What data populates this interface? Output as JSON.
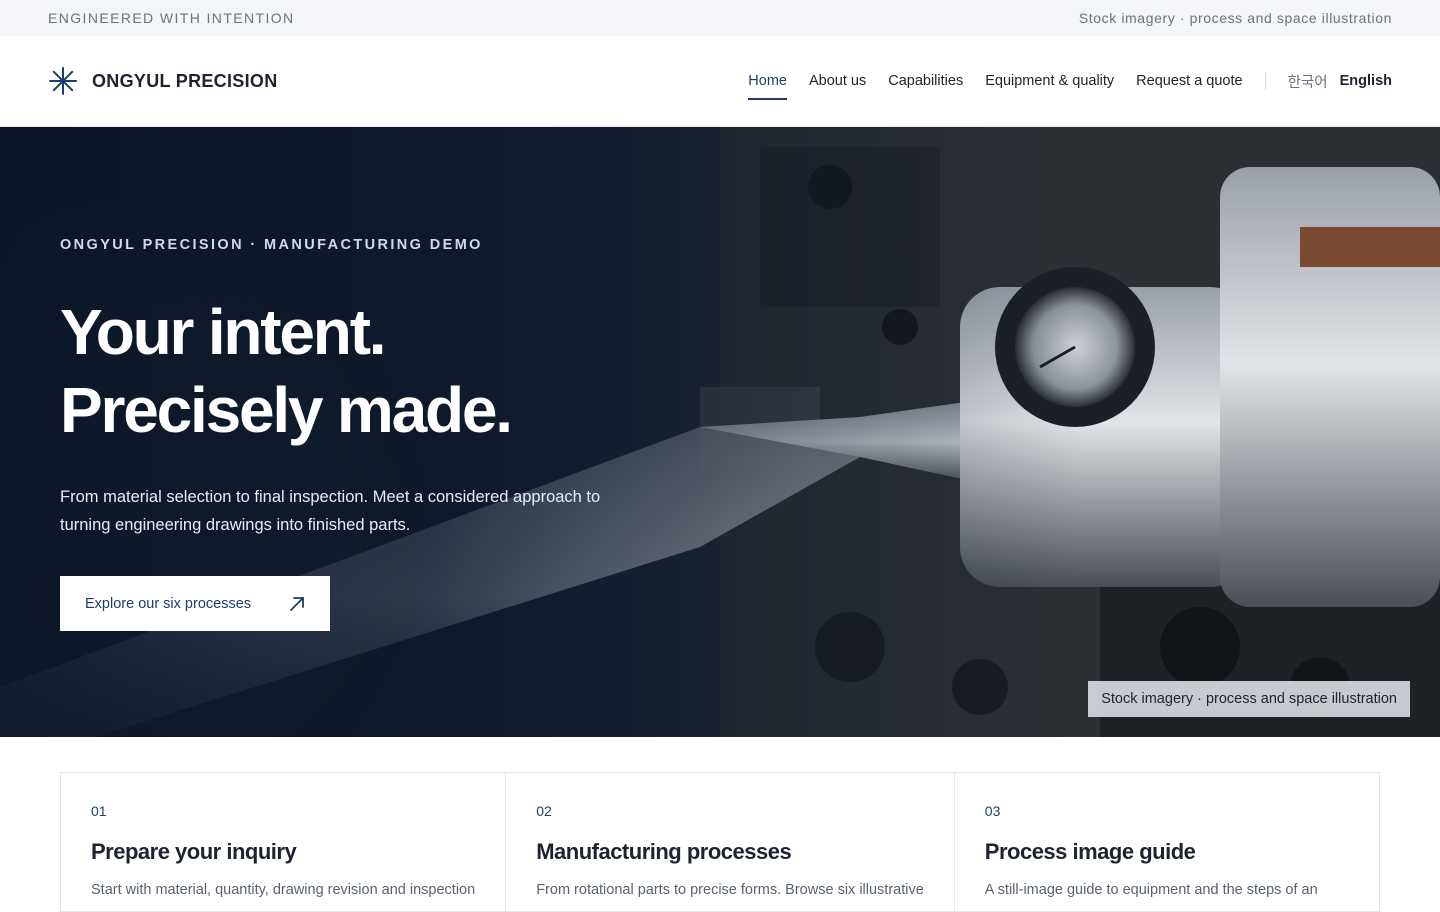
{
  "topbar": {
    "tagline": "ENGINEERED WITH INTENTION",
    "note": "Stock imagery · process and space illustration"
  },
  "header": {
    "brand": "ONGYUL PRECISION",
    "nav": [
      {
        "label": "Home",
        "active": true
      },
      {
        "label": "About us",
        "active": false
      },
      {
        "label": "Capabilities",
        "active": false
      },
      {
        "label": "Equipment & quality",
        "active": false
      },
      {
        "label": "Request a quote",
        "active": false
      }
    ],
    "languages": {
      "korean": "한국어",
      "english": "English",
      "selected": "English"
    }
  },
  "hero": {
    "eyebrow": "ONGYUL PRECISION · MANUFACTURING DEMO",
    "headline_line1": "Your intent.",
    "headline_line2": "Precisely made.",
    "lede": "From material selection to final inspection. Meet a considered approach to turning engineering drawings into finished parts.",
    "cta_label": "Explore our six processes",
    "image_credit": "Stock imagery · process and space illustration"
  },
  "cards": [
    {
      "number": "01",
      "title": "Prepare your inquiry",
      "text": "Start with material, quantity, drawing revision and inspection"
    },
    {
      "number": "02",
      "title": "Manufacturing processes",
      "text": "From rotational parts to precise forms. Browse six illustrative"
    },
    {
      "number": "03",
      "title": "Process image guide",
      "text": "A still-image guide to equipment and the steps of an"
    }
  ],
  "colors": {
    "accent": "#1c3d6b",
    "topbar_bg": "#f3f5f8",
    "hero_dark": "#0d1a2c"
  }
}
